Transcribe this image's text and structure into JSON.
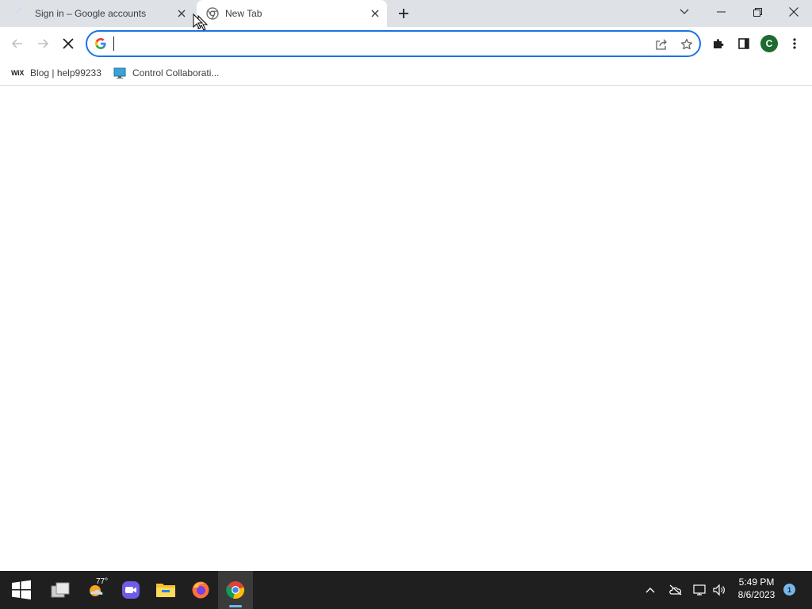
{
  "browser": {
    "tabs": [
      {
        "title": "Sign in – Google accounts",
        "state": "loading",
        "active": false
      },
      {
        "title": "New Tab",
        "state": "loaded",
        "active": true
      }
    ],
    "window_controls": [
      "tab-search",
      "minimize",
      "restore",
      "close"
    ]
  },
  "toolbar": {
    "address_value": "",
    "profile_initial": "C"
  },
  "bookmarks": [
    {
      "label": "Blog | help99233",
      "icon": "wix-logo"
    },
    {
      "label": "Control Collaborati...",
      "icon": "monitor-icon"
    }
  ],
  "taskbar": {
    "weather_temp": "77°",
    "clock_time": "5:49 PM",
    "clock_date": "8/6/2023",
    "notification_count": "1",
    "apps": [
      "start",
      "task-view",
      "weather",
      "zoom",
      "file-explorer",
      "firefox",
      "chrome"
    ]
  },
  "colors": {
    "accent": "#1a73e8",
    "tabstrip": "#dee1e6",
    "taskbar": "#1f1f1f",
    "profile_avatar": "#1e6b2f",
    "taskbar_highlight": "#76b9ed"
  }
}
